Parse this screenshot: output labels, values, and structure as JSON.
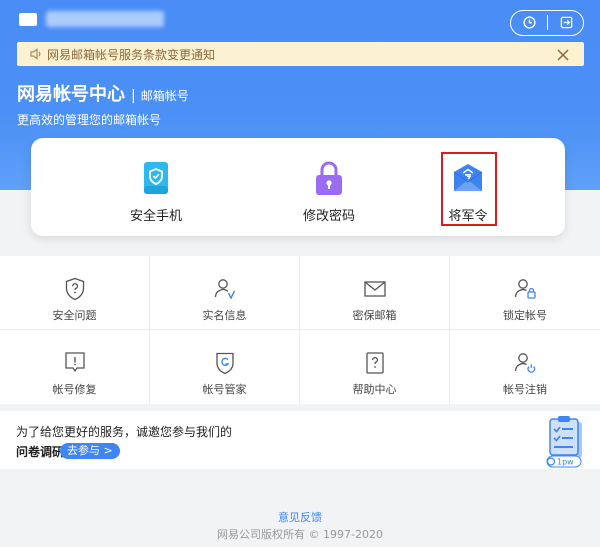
{
  "header": {
    "notice_text": "网易邮箱帐号服务条款变更通知",
    "title": "网易帐号中心",
    "divider": "|",
    "title_sub": "邮箱帐号",
    "subtitle": "更高效的管理您的邮箱帐号"
  },
  "quick_actions": [
    {
      "label": "安全手机",
      "icon": "phone-shield-icon",
      "color": "#2fb8f0"
    },
    {
      "label": "修改密码",
      "icon": "lock-icon",
      "color": "#9a6cf2"
    },
    {
      "label": "将军令",
      "icon": "token-envelope-icon",
      "color": "#3f82f2"
    }
  ],
  "grid_items": [
    {
      "label": "安全问题",
      "icon": "shield-question-icon"
    },
    {
      "label": "实名信息",
      "icon": "user-verified-icon"
    },
    {
      "label": "密保邮箱",
      "icon": "mail-icon"
    },
    {
      "label": "锁定帐号",
      "icon": "user-lock-icon"
    },
    {
      "label": "帐号修复",
      "icon": "chat-alert-icon"
    },
    {
      "label": "帐号管家",
      "icon": "shield-g-icon"
    },
    {
      "label": "帮助中心",
      "icon": "help-doc-icon"
    },
    {
      "label": "帐号注销",
      "icon": "user-power-icon"
    }
  ],
  "survey": {
    "line1": "为了给您更好的服务，诚邀您参与我们的",
    "line2": "问卷调研",
    "button": "去参与 >",
    "badge": "1pw"
  },
  "footer": {
    "feedback": "意见反馈",
    "copyright": "网易公司版权所有 © 1997-2020"
  },
  "colors": {
    "brand_blue": "#4a8cf5",
    "notice_bg": "#fcf1d1",
    "highlight_red": "#e0191e"
  }
}
